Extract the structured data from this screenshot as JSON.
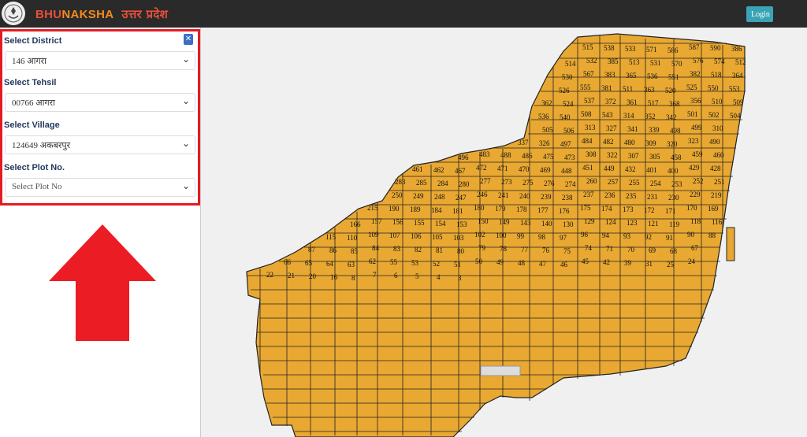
{
  "header": {
    "brand_part1": "BHU",
    "brand_part2": "NAKSHA",
    "brand_hindi": "उत्तर प्रदेश",
    "login_label": "Login",
    "logo_icon": "state-emblem-icon"
  },
  "sidebar": {
    "close_icon": "close-icon",
    "fields": [
      {
        "label": "Select District",
        "value": "146 आगरा"
      },
      {
        "label": "Select Tehsil",
        "value": "00766 आगरा"
      },
      {
        "label": "Select Village",
        "value": "124649 अकबरपुर"
      },
      {
        "label": "Select Plot No.",
        "value": "Select Plot No"
      }
    ],
    "arrow_icon": "red-up-arrow-icon"
  },
  "map": {
    "fill_color": "#e8a832",
    "background_color": "#f0f0f0",
    "plot_numbers": [
      "515",
      "538",
      "533",
      "571",
      "586",
      "587",
      "590",
      "386",
      "514",
      "532",
      "385",
      "513",
      "531",
      "570",
      "576",
      "574",
      "512",
      "530",
      "567",
      "383",
      "365",
      "536",
      "551",
      "382",
      "518",
      "364",
      "526",
      "555",
      "381",
      "511",
      "363",
      "520",
      "525",
      "550",
      "553",
      "362",
      "524",
      "537",
      "372",
      "361",
      "517",
      "368",
      "356",
      "510",
      "509",
      "536",
      "540",
      "508",
      "543",
      "314",
      "352",
      "342",
      "501",
      "502",
      "504",
      "505",
      "506",
      "313",
      "327",
      "341",
      "339",
      "498",
      "499",
      "310",
      "337",
      "326",
      "497",
      "484",
      "482",
      "480",
      "309",
      "320",
      "323",
      "490",
      "496",
      "483",
      "488",
      "486",
      "475",
      "473",
      "308",
      "322",
      "307",
      "305",
      "458",
      "459",
      "460",
      "461",
      "462",
      "467",
      "472",
      "471",
      "470",
      "469",
      "448",
      "451",
      "449",
      "432",
      "401",
      "400",
      "429",
      "428",
      "283",
      "285",
      "284",
      "280",
      "277",
      "273",
      "275",
      "276",
      "274",
      "260",
      "257",
      "255",
      "254",
      "253",
      "252",
      "251",
      "250",
      "249",
      "248",
      "247",
      "246",
      "241",
      "240",
      "239",
      "238",
      "237",
      "236",
      "235",
      "231",
      "230",
      "229",
      "219",
      "215",
      "190",
      "189",
      "184",
      "181",
      "180",
      "179",
      "178",
      "177",
      "176",
      "175",
      "174",
      "173",
      "172",
      "171",
      "170",
      "169",
      "166",
      "157",
      "156",
      "155",
      "154",
      "153",
      "150",
      "149",
      "143",
      "140",
      "130",
      "129",
      "124",
      "123",
      "121",
      "119",
      "118",
      "116",
      "115",
      "110",
      "109",
      "107",
      "106",
      "105",
      "103",
      "102",
      "100",
      "99",
      "98",
      "97",
      "96",
      "94",
      "93",
      "92",
      "91",
      "90",
      "88",
      "87",
      "86",
      "85",
      "84",
      "83",
      "82",
      "81",
      "80",
      "79",
      "78",
      "77",
      "76",
      "75",
      "74",
      "71",
      "70",
      "69",
      "68",
      "67",
      "66",
      "65",
      "64",
      "63",
      "62",
      "55",
      "53",
      "52",
      "51",
      "50",
      "49",
      "48",
      "47",
      "46",
      "45",
      "42",
      "39",
      "31",
      "25",
      "24",
      "22",
      "21",
      "20",
      "16",
      "8",
      "7",
      "6",
      "5",
      "4",
      "3"
    ]
  }
}
